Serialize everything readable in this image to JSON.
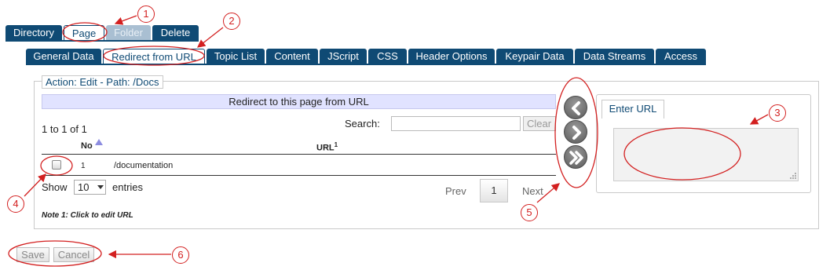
{
  "top_tabs": [
    {
      "label": "Directory",
      "state": "normal"
    },
    {
      "label": "Page",
      "state": "active"
    },
    {
      "label": "Folder",
      "state": "disabled"
    },
    {
      "label": "Delete",
      "state": "normal"
    }
  ],
  "sub_tabs": [
    {
      "label": "General Data",
      "state": "normal"
    },
    {
      "label": "Redirect from URL",
      "state": "active"
    },
    {
      "label": "Topic List",
      "state": "normal"
    },
    {
      "label": "Content",
      "state": "normal"
    },
    {
      "label": "JScript",
      "state": "normal"
    },
    {
      "label": "CSS",
      "state": "normal"
    },
    {
      "label": "Header Options",
      "state": "normal"
    },
    {
      "label": "Keypair Data",
      "state": "normal"
    },
    {
      "label": "Data Streams",
      "state": "normal"
    },
    {
      "label": "Access",
      "state": "normal"
    }
  ],
  "panel": {
    "legend": "Action: Edit - Path: /Docs",
    "table_title": "Redirect to this page from URL",
    "count_text": "1 to 1 of 1",
    "search_label": "Search:",
    "search_value": "",
    "clear_label": "Clear",
    "columns": {
      "no": "No",
      "url": "URL",
      "url_sup": "1"
    },
    "rows": [
      {
        "no": "1",
        "url": "/documentation",
        "checked": false
      }
    ],
    "show_label": "Show",
    "entries_value": "10",
    "entries_label": "entries",
    "pager": {
      "prev": "Prev",
      "page": "1",
      "next": "Next"
    },
    "note": "Note 1: Click to edit URL"
  },
  "url_panel": {
    "tab_label": "Enter URL",
    "value": ""
  },
  "actions": {
    "save": "Save",
    "cancel": "Cancel"
  },
  "callouts": [
    "1",
    "2",
    "3",
    "4",
    "5",
    "6"
  ],
  "colors": {
    "tab_blue": "#0f4a74",
    "annotation_red": "#d32020",
    "table_header": "#e1e3ff"
  }
}
